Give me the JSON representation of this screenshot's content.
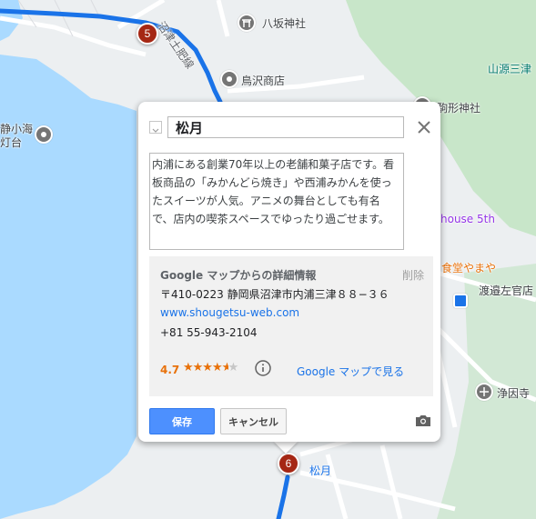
{
  "map": {
    "labels": {
      "hassaka": "八坂神社",
      "karasuzawa": "鳥沢商店",
      "sangen": "山源三津",
      "komagata": "駒形神社",
      "lighthouse_1": "静小海",
      "lighthouse_2": "灯台",
      "house5th": "house 5th",
      "shokudo": "食堂やまや",
      "watari": "渡邉左官店",
      "join": "浄因寺",
      "shogetsu": "松月",
      "road": "沼津土肥線"
    },
    "markers": {
      "m5": "5",
      "m6": "6"
    }
  },
  "popup": {
    "title_value": "松月",
    "description": "内浦にある創業70年以上の老舗和菓子店です。看板商品の「みかんどら焼き」や西浦みかんを使ったスイーツが人気。アニメの舞台としても有名で、店内の喫茶スペースでゆったり過ごせます。",
    "google": {
      "heading": "Google マップからの詳細情報",
      "delete_label": "削除",
      "address": "〒410-0223 静岡県沼津市内浦三津８８−３６",
      "website": "www.shougetsu-web.com",
      "phone": "+81 55-943-2104",
      "rating": "4.7",
      "view_label": "Google マップで見る"
    },
    "save_label": "保存",
    "cancel_label": "キャンセル"
  },
  "colors": {
    "accent": "#4d90fe",
    "marker": "#a52714",
    "rating": "#e8710a",
    "route": "#1a73e8"
  }
}
